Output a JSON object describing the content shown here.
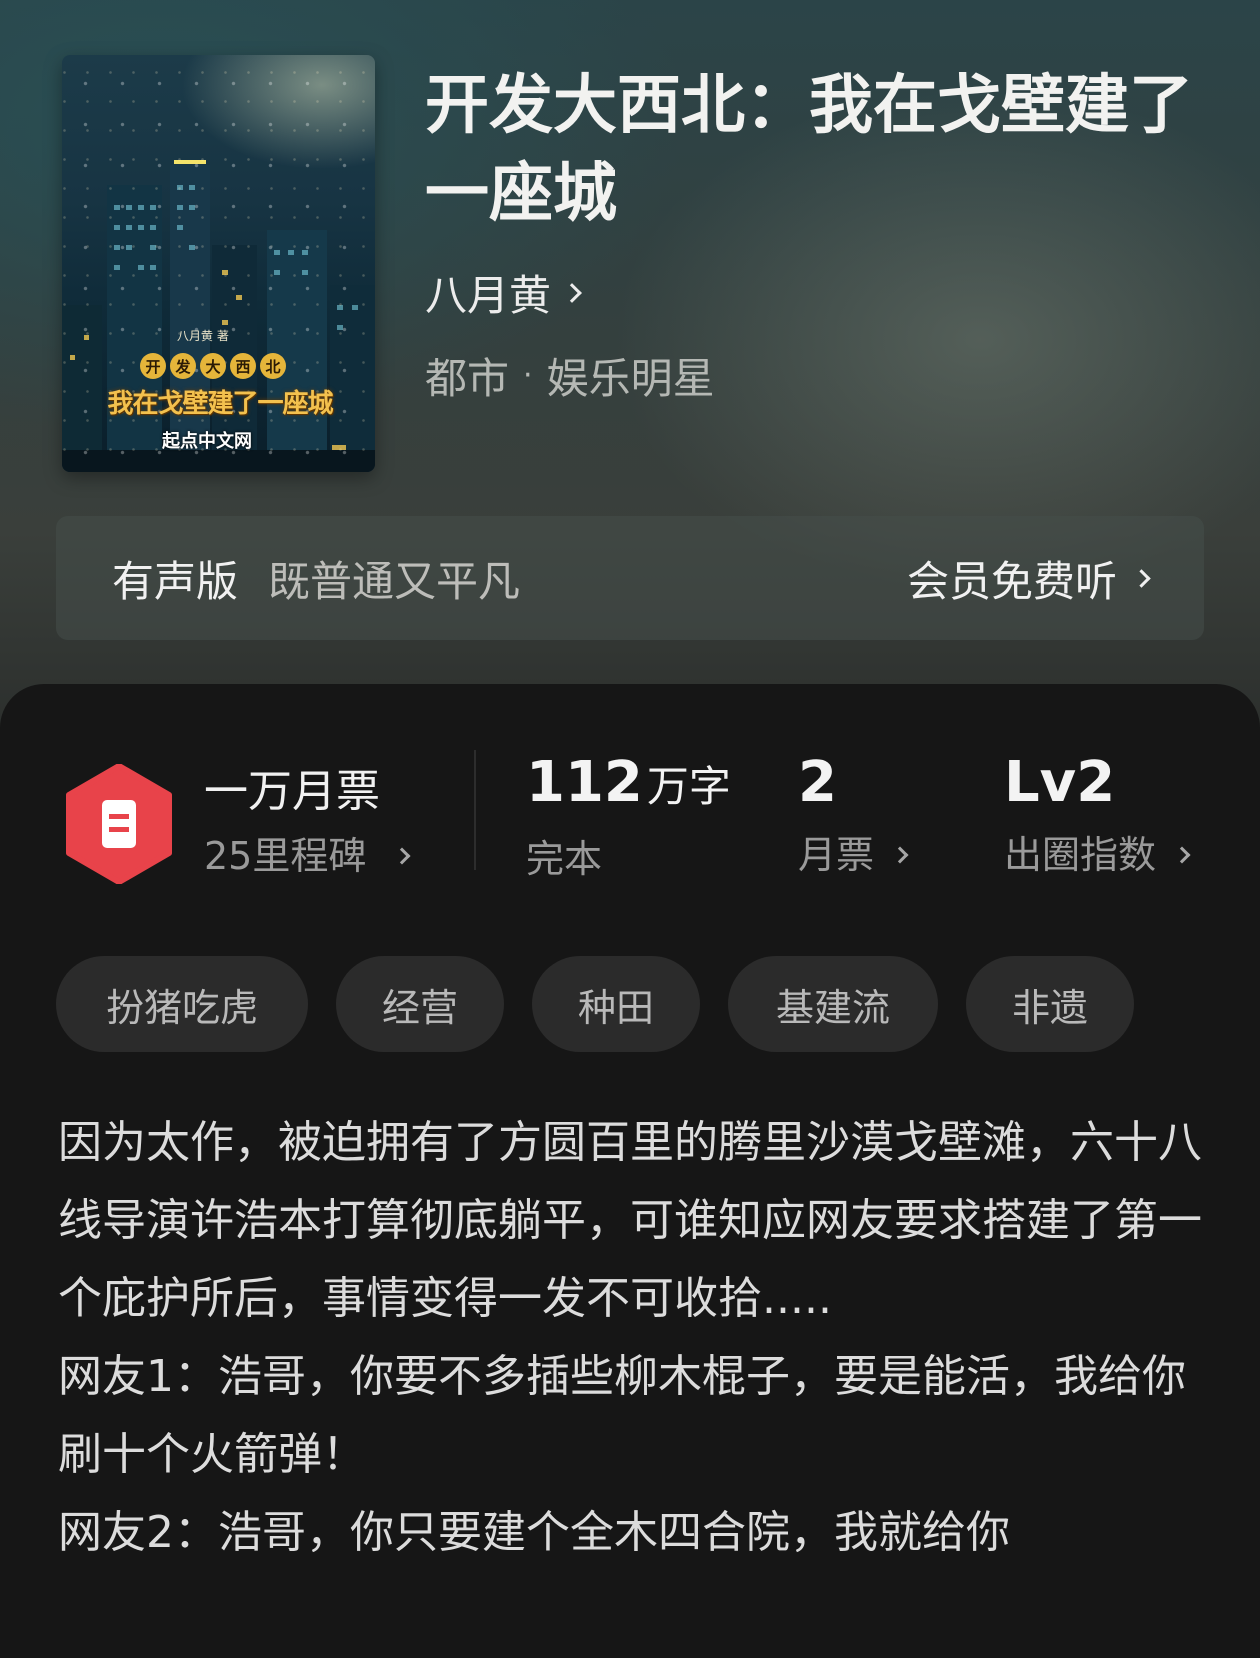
{
  "book": {
    "title": "开发大西北：我在戈壁建了一座城",
    "author": "八月黄",
    "genre_main": "都市",
    "genre_sep": "·",
    "genre_sub": "娱乐明星",
    "cover": {
      "author_line": "八月黄 著",
      "title_top": [
        "开",
        "发",
        "大",
        "西",
        "北"
      ],
      "title_bottom": "我在戈壁建了一座城",
      "publisher": "起点中文网"
    }
  },
  "audio": {
    "label": "有声版",
    "narrator": "既普通又平凡",
    "action": "会员免费听"
  },
  "stats": {
    "ticket_title": "一万月票",
    "ticket_sub": "25里程碑",
    "words_value": "112",
    "words_unit": "万字",
    "words_status": "完本",
    "monthly_value": "2",
    "monthly_label": "月票",
    "level_value": "Lv2",
    "level_label": "出圈指数"
  },
  "tags": [
    "扮猪吃虎",
    "经营",
    "种田",
    "基建流",
    "非遗"
  ],
  "synopsis": [
    "因为太作，被迫拥有了方圆百里的腾里沙漠戈壁滩，六十八线导演许浩本打算彻底躺平，可谁知应网友要求搭建了第一个庇护所后，事情变得一发不可收拾.....",
    "网友1：浩哥，你要不多插些柳木棍子，要是能活，我给你刷十个火箭弹！",
    "网友2：浩哥，你只要建个全木四合院，我就给你"
  ],
  "colors": {
    "ticket_icon": "#e8434a",
    "panel_bg": "#161616",
    "tag_bg": "#2b2b2b"
  }
}
